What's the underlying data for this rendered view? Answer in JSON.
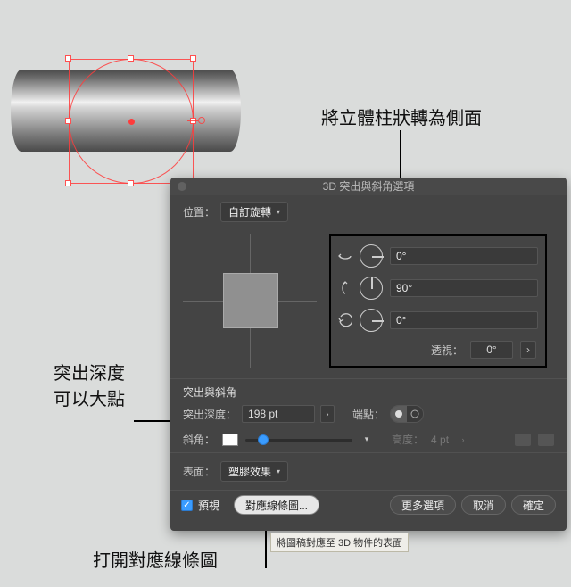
{
  "annotations": {
    "rotate_note": "將立體柱狀轉為側面",
    "depth_note_l1": "突出深度",
    "depth_note_l2": "可以大點",
    "map_art_note": "打開對應線條圖"
  },
  "dialog": {
    "title": "3D 突出與斜角選項",
    "position_label": "位置：",
    "position_value": "自訂旋轉",
    "angles": {
      "x": "0°",
      "y": "90°",
      "z": "0°"
    },
    "perspective_label": "透視：",
    "perspective_value": "0°",
    "section_extrude": "突出與斜角",
    "depth_label": "突出深度：",
    "depth_value": "198 pt",
    "cap_label": "端點：",
    "bevel_label": "斜角：",
    "height_label": "高度：",
    "height_value": "4 pt",
    "surface_label": "表面：",
    "surface_value": "塑膠效果",
    "preview_label": "預視",
    "btn_map_art": "對應線條圖...",
    "btn_more": "更多選項",
    "btn_cancel": "取消",
    "btn_ok": "確定",
    "tooltip": "將圖稿對應至 3D 物件的表面"
  }
}
